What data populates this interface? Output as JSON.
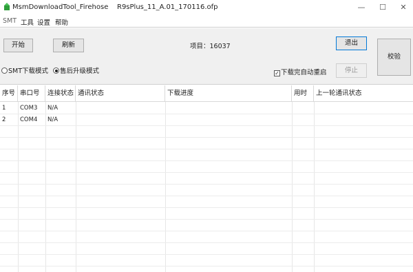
{
  "window": {
    "app_title": "MsmDownloadTool_Firehose",
    "file_title": "R9sPlus_11_A.01_170116.ofp",
    "minimize_glyph": "—",
    "maximize_glyph": "☐",
    "close_glyph": "✕"
  },
  "menu": {
    "items": [
      {
        "label": "SMT"
      },
      {
        "label": "工具"
      },
      {
        "label": "设置"
      },
      {
        "label": "帮助"
      }
    ]
  },
  "toolbar": {
    "start_label": "开始",
    "refresh_label": "刷新",
    "project_label": "项目：16037",
    "exit_label": "退出",
    "stop_label": "停止",
    "verify_label": "校验"
  },
  "modes": {
    "smt_label": "SMT下载模式",
    "smt_selected": false,
    "post_label": "售后升级模式",
    "post_selected": true,
    "auto_reboot_label": "下载完自动重启",
    "auto_reboot_checked": true
  },
  "table": {
    "columns": [
      "序号",
      "串口号",
      "连接状态",
      "通讯状态",
      "下载进度",
      "用时",
      "上一轮通讯状态"
    ],
    "rows": [
      {
        "index": "1",
        "port": "COM3",
        "connection": "N/A",
        "comm": "",
        "progress": "",
        "time": "",
        "last": ""
      },
      {
        "index": "2",
        "port": "COM4",
        "connection": "N/A",
        "comm": "",
        "progress": "",
        "time": "",
        "last": ""
      }
    ]
  },
  "colors": {
    "accent": "#0078d7",
    "toolbar_bg": "#f0f0f0",
    "grid_line": "#d8d8d8",
    "icon_green": "#2e9e3a"
  },
  "icons": [
    "app-icon",
    "minimize-icon",
    "maximize-icon",
    "close-icon"
  ]
}
